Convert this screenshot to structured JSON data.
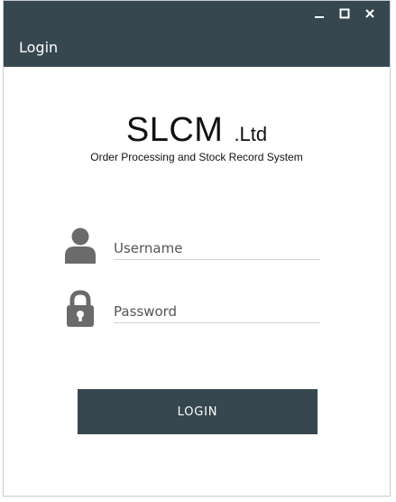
{
  "window": {
    "controls": [
      "minimize",
      "maximize",
      "close"
    ]
  },
  "header": {
    "title": "Login"
  },
  "brand": {
    "name": "SLCM",
    "suffix": ".Ltd",
    "subtitle": "Order Processing and Stock Record System"
  },
  "form": {
    "username": {
      "placeholder": "Username",
      "value": "",
      "icon": "user-icon"
    },
    "password": {
      "placeholder": "Password",
      "value": "",
      "icon": "lock-icon"
    },
    "submit_label": "LOGIN"
  },
  "colors": {
    "primary": "#37474f",
    "text": "#111111",
    "underline": "#cfd3d6",
    "icon": "#6b6b6b"
  }
}
